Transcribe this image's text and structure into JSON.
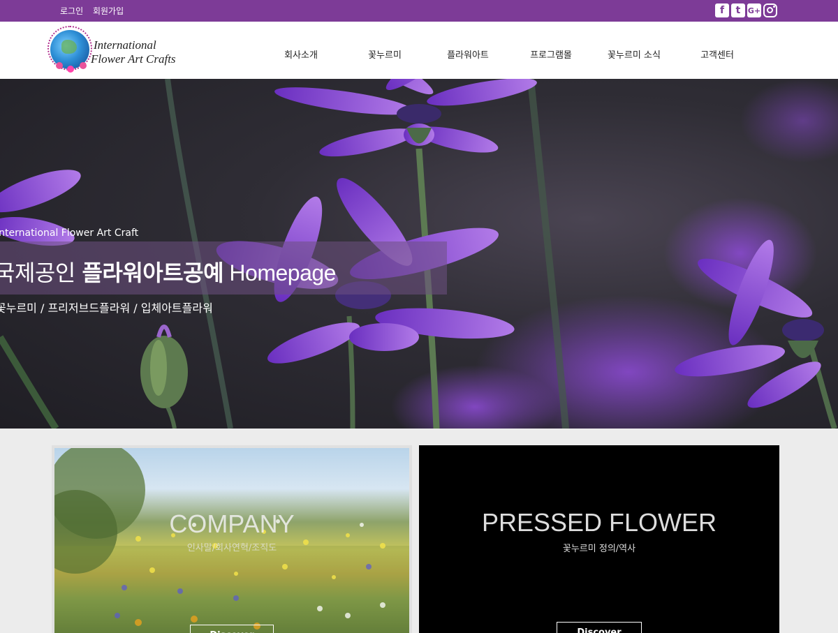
{
  "topbar": {
    "login": "로그인",
    "signup": "회원가입",
    "social": {
      "facebook": "f",
      "twitter": "t",
      "google": "G+"
    }
  },
  "logo": {
    "line1": "International",
    "line2": "Flower Art Crafts"
  },
  "nav": [
    "회사소개",
    "꽃누르미",
    "플라워아트",
    "프로그램몰",
    "꽃누르미 소식",
    "고객센터"
  ],
  "hero": {
    "small": "International Flower Art Craft",
    "main_pre": "국제공인 ",
    "main_bold": "플라워아트공예",
    "main_en": " Homepage",
    "sub": "꽃누르미 / 프리저브드플라워 / 입체아트플라워"
  },
  "cards": [
    {
      "title": "COMPANY",
      "sub": "인사말/회사연혁/조직도",
      "button": "Discover"
    },
    {
      "title": "PRESSED FLOWER",
      "sub": "꽃누르미 정의/역사",
      "button": "Discover"
    }
  ],
  "colors": {
    "topbar": "#7d3b97",
    "accent_purple": "#8a3fd6"
  }
}
